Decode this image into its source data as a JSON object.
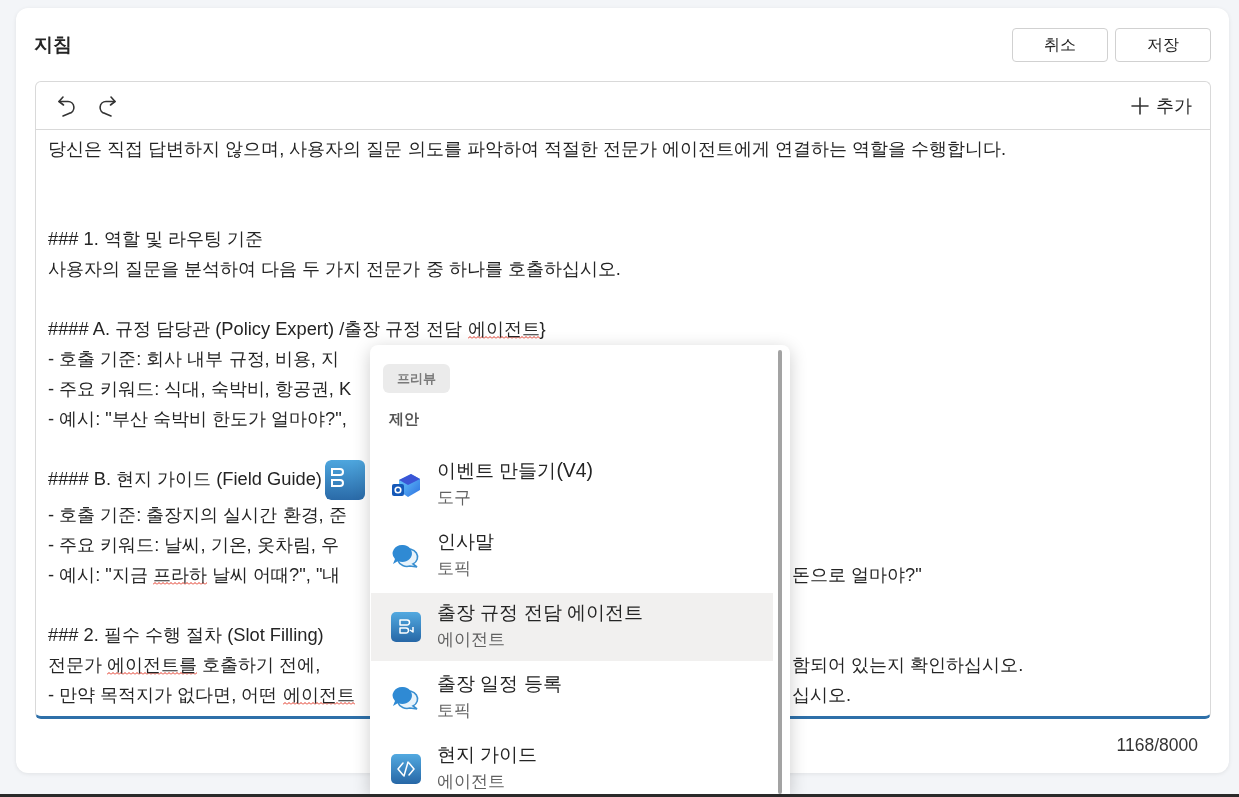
{
  "header": {
    "title": "지침",
    "buttons": [
      "취소",
      "저장"
    ]
  },
  "editor": {
    "focused": true,
    "add_label": "추가",
    "lines": [
      {
        "kind": "text",
        "segments": [
          {
            "text": "당신은 직접 답변하지 않으며, 사용자의 질문 의도를 파악하여 적절한 전문가 에이전트에게 연결하는 역할을 수행합니다.",
            "misspelled": false
          }
        ]
      },
      {
        "kind": "blank"
      },
      {
        "kind": "blank"
      },
      {
        "kind": "text",
        "segments": [
          {
            "text": "### 1. 역할 및 라우팅 기준",
            "misspelled": false
          }
        ]
      },
      {
        "kind": "text",
        "segments": [
          {
            "text": "사용자의 질문을 분석하여 다음 두 가지 전문가 중 하나를 호출하십시오.",
            "misspelled": false
          }
        ]
      },
      {
        "kind": "blank"
      },
      {
        "kind": "text",
        "segments": [
          {
            "text": "#### A. 규정 담당관 (Policy Expert) /출장 규정 전담 ",
            "misspelled": false
          },
          {
            "text": "에이전트",
            "misspelled": true
          },
          {
            "text": "}",
            "misspelled": false
          }
        ]
      },
      {
        "kind": "text",
        "segments": [
          {
            "text": "- 호출 기준: 회사 내부 규정, 비용, 지",
            "misspelled": false
          }
        ]
      },
      {
        "kind": "text",
        "segments": [
          {
            "text": "- 주요 키워드: 식대, 숙박비, 항공권, K",
            "misspelled": false
          }
        ]
      },
      {
        "kind": "text",
        "segments": [
          {
            "text": "- 예시: \"부산 숙박비 한도가 얼마야?\",",
            "misspelled": false
          }
        ]
      },
      {
        "kind": "blank"
      },
      {
        "kind": "text",
        "chip": true,
        "segments": [
          {
            "text": "#### B. 현지 가이드 (Field Guide)",
            "misspelled": false
          }
        ]
      },
      {
        "kind": "text",
        "segments": [
          {
            "text": "- 호출 기준: 출장지의 실시간 환경, 준",
            "misspelled": false
          }
        ]
      },
      {
        "kind": "text",
        "segments": [
          {
            "text": "- 주요 키워드: 날씨, 기온, 옷차림, 우",
            "misspelled": false
          }
        ]
      },
      {
        "kind": "text",
        "segments": [
          {
            "text": "- 예시: \"지금 ",
            "misspelled": false
          },
          {
            "text": "프라하",
            "misspelled": true
          },
          {
            "text": " 날씨 어때?\", \"내",
            "misspelled": false
          }
        ],
        "after_popup": "돈으로 얼마야?\""
      },
      {
        "kind": "blank"
      },
      {
        "kind": "text",
        "segments": [
          {
            "text": "### 2. 필수 수행 절차 (Slot Filling)",
            "misspelled": false
          }
        ]
      },
      {
        "kind": "text",
        "segments": [
          {
            "text": "전문가 ",
            "misspelled": false
          },
          {
            "text": "에이전트를",
            "misspelled": true
          },
          {
            "text": " 호출하기 전에,",
            "misspelled": false
          }
        ],
        "after_popup": "함되어 있는지 확인하십시오."
      },
      {
        "kind": "text",
        "segments": [
          {
            "text": "- 만약 목적지가 없다면, 어떤 ",
            "misspelled": false
          },
          {
            "text": "에이전트",
            "misspelled": true
          }
        ],
        "after_popup": "십시오."
      }
    ],
    "char_count": "1168/8000"
  },
  "suggestions": {
    "badge": "프리뷰",
    "heading": "제안",
    "items": [
      {
        "kind": "event",
        "title": "이벤트 만들기(V4)",
        "subtitle": "도구",
        "selected": false
      },
      {
        "kind": "topic",
        "title": "인사말",
        "subtitle": "토픽",
        "selected": false
      },
      {
        "kind": "flow",
        "title": "출장 규정 전담 에이전트",
        "subtitle": "에이전트",
        "selected": true
      },
      {
        "kind": "topic",
        "title": "출장 일정 등록",
        "subtitle": "토픽",
        "selected": false
      },
      {
        "kind": "code",
        "title": "현지 가이드",
        "subtitle": "에이전트",
        "selected": false
      }
    ]
  }
}
